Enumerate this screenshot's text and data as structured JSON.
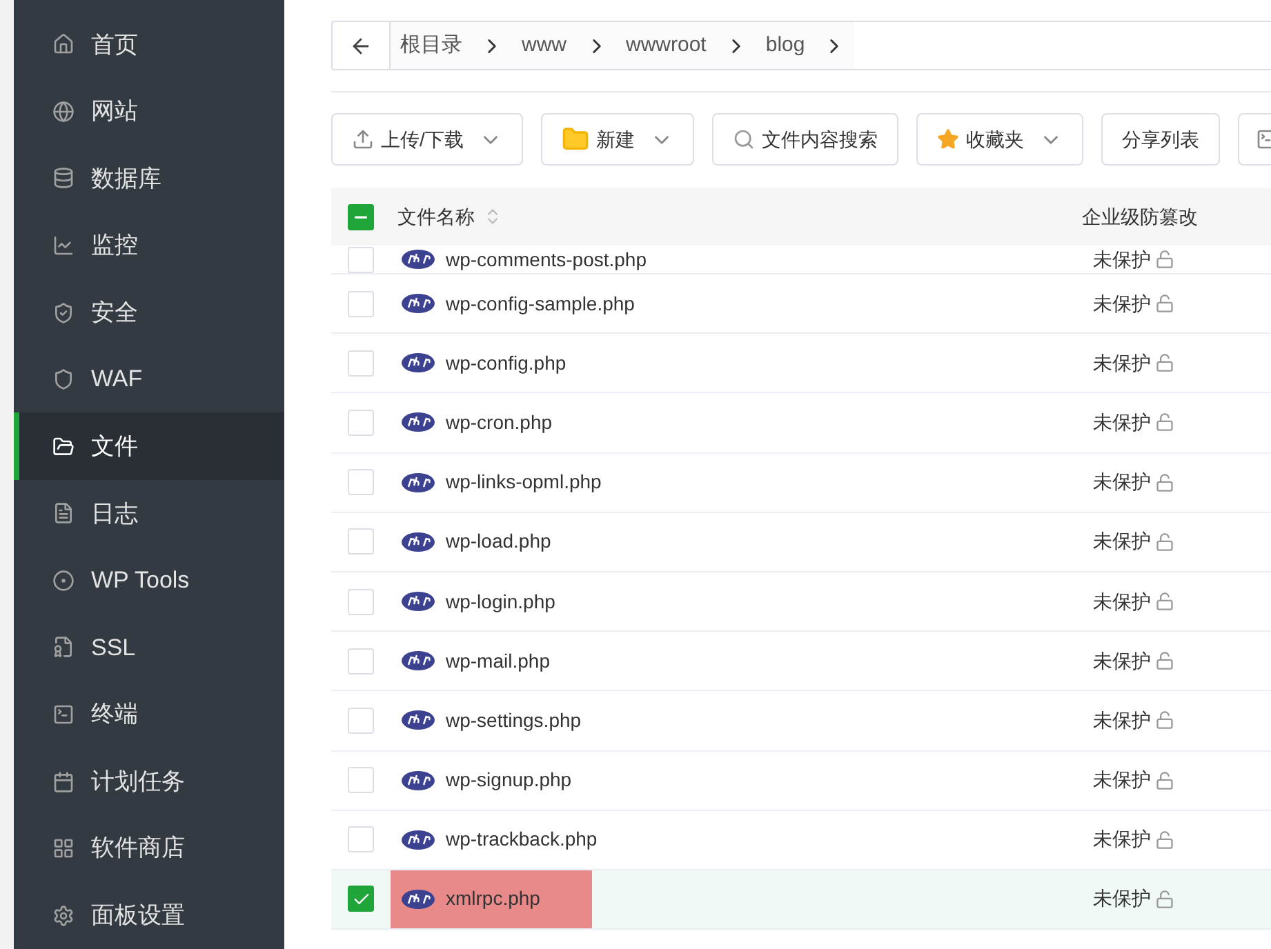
{
  "sidebar": {
    "items": [
      {
        "label": "首页",
        "selected": false
      },
      {
        "label": "网站",
        "selected": false
      },
      {
        "label": "数据库",
        "selected": false
      },
      {
        "label": "监控",
        "selected": false
      },
      {
        "label": "安全",
        "selected": false
      },
      {
        "label": "WAF",
        "selected": false
      },
      {
        "label": "文件",
        "selected": true
      },
      {
        "label": "日志",
        "selected": false
      },
      {
        "label": "WP Tools",
        "selected": false
      },
      {
        "label": "SSL",
        "selected": false
      },
      {
        "label": "终端",
        "selected": false
      },
      {
        "label": "计划任务",
        "selected": false
      },
      {
        "label": "软件商店",
        "selected": false
      },
      {
        "label": "面板设置",
        "selected": false
      }
    ]
  },
  "breadcrumb": [
    "根目录",
    "www",
    "wwwroot",
    "blog"
  ],
  "toolbar": [
    {
      "label": "上传/下载",
      "dropdown": true
    },
    {
      "label": "新建",
      "dropdown": true
    },
    {
      "label": "文件内容搜索",
      "dropdown": false
    },
    {
      "label": "收藏夹",
      "dropdown": true
    },
    {
      "label": "分享列表",
      "dropdown": false
    }
  ],
  "table": {
    "header_partial": true,
    "columns": [
      "文件名称",
      "企业级防篡改"
    ],
    "rows": [
      {
        "name": "wp-comments-post.php",
        "status": "未保护",
        "checked": false,
        "selected": false,
        "highlighted": false
      },
      {
        "name": "wp-config-sample.php",
        "status": "未保护",
        "checked": false,
        "selected": false,
        "highlighted": false
      },
      {
        "name": "wp-config.php",
        "status": "未保护",
        "checked": false,
        "selected": false,
        "highlighted": false
      },
      {
        "name": "wp-cron.php",
        "status": "未保护",
        "checked": false,
        "selected": false,
        "highlighted": false
      },
      {
        "name": "wp-links-opml.php",
        "status": "未保护",
        "checked": false,
        "selected": false,
        "highlighted": false
      },
      {
        "name": "wp-load.php",
        "status": "未保护",
        "checked": false,
        "selected": false,
        "highlighted": false
      },
      {
        "name": "wp-login.php",
        "status": "未保护",
        "checked": false,
        "selected": false,
        "highlighted": false
      },
      {
        "name": "wp-mail.php",
        "status": "未保护",
        "checked": false,
        "selected": false,
        "highlighted": false
      },
      {
        "name": "wp-settings.php",
        "status": "未保护",
        "checked": false,
        "selected": false,
        "highlighted": false
      },
      {
        "name": "wp-signup.php",
        "status": "未保护",
        "checked": false,
        "selected": false,
        "highlighted": false
      },
      {
        "name": "wp-trackback.php",
        "status": "未保护",
        "checked": false,
        "selected": false,
        "highlighted": false
      },
      {
        "name": "xmlrpc.php",
        "status": "未保护",
        "checked": true,
        "selected": true,
        "highlighted": true
      }
    ]
  }
}
